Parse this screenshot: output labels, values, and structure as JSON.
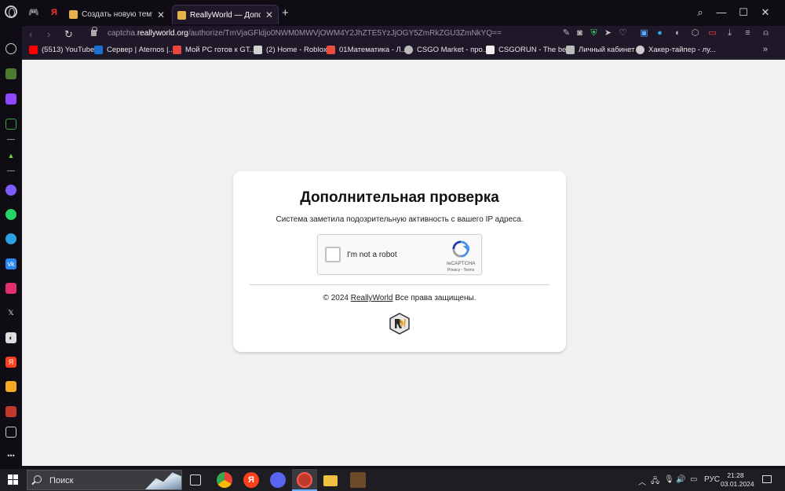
{
  "tabs": [
    {
      "title": "",
      "kind": "opera-gx-icon"
    },
    {
      "title": "",
      "kind": "yandex-icon"
    },
    {
      "title": "Создать новую тему - ReallyWorld"
    },
    {
      "title": "ReallyWorld — Дополнительная проверка",
      "active": true
    }
  ],
  "address": {
    "url_prefix": "captcha.",
    "url_domain": "reallyworld.org",
    "url_path": "/authorize/TmVjaGFldjo0NWM0MWVjOWM4Y2JhZTE5YzJjOGY5ZmRkZGU3ZmNkYQ=="
  },
  "bookmarks": [
    {
      "label": "(5513) YouTube",
      "color": "#ff0000"
    },
    {
      "label": "Сервер | Aternos |...",
      "color": "#1b6fd1"
    },
    {
      "label": "Мой PC готов к GT...",
      "color": "#e8463d"
    },
    {
      "label": "(2) Home - Roblox",
      "color": "#d0d0d0"
    },
    {
      "label": "01Математика - Л...",
      "color": "#e84d3d"
    },
    {
      "label": "CSGO Market - про...",
      "color": "#bbbbbb"
    },
    {
      "label": "CSGORUN - The be...",
      "color": "#eeeeee"
    },
    {
      "label": "Личный кабинет",
      "color": "#bbbbbb"
    },
    {
      "label": "Хакер-тайпер - лу...",
      "color": "#cccccc"
    }
  ],
  "card": {
    "title": "Дополнительная проверка",
    "subtitle": "Система заметила подозрительную активность с вашего IP адреса.",
    "recaptcha": {
      "label": "I'm not a robot",
      "brand": "reCAPTCHA",
      "links": "Privacy - Terms"
    },
    "footer_prefix": "© 2024 ",
    "footer_link": "ReallyWorld",
    "footer_suffix": " Все права защищены."
  },
  "taskbar": {
    "search_placeholder": "Поиск",
    "language": "РУС",
    "time": "21:28",
    "date": "03.01.2024"
  },
  "colors": {
    "page_bg": "#f1f1f1",
    "browser_bg": "#1e1828",
    "accent": "#ff3b4f"
  }
}
